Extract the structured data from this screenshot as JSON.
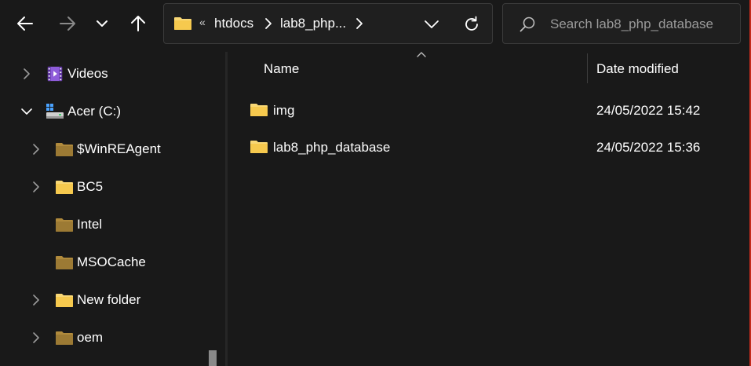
{
  "toolbar": {
    "back_icon": "arrow-left-icon",
    "forward_icon": "arrow-right-icon",
    "recent_icon": "chevron-down-icon",
    "up_icon": "arrow-up-icon"
  },
  "address": {
    "overflow_marker": "«",
    "crumbs": [
      "htdocs",
      "lab8_php..."
    ],
    "folder_icon": "folder-icon",
    "dropdown_icon": "chevron-down-icon",
    "refresh_icon": "refresh-icon"
  },
  "search": {
    "placeholder": "Search lab8_php_database",
    "icon": "search-icon"
  },
  "sidebar": {
    "items": [
      {
        "label": "Videos",
        "icon": "videos-folder-icon",
        "expander": "collapsed"
      },
      {
        "label": "Acer (C:)",
        "icon": "drive-icon",
        "expander": "expanded"
      },
      {
        "label": "$WinREAgent",
        "icon": "folder-icon",
        "expander": "collapsed"
      },
      {
        "label": "BC5",
        "icon": "folder-icon",
        "expander": "collapsed"
      },
      {
        "label": "Intel",
        "icon": "folder-icon",
        "expander": "none"
      },
      {
        "label": "MSOCache",
        "icon": "folder-icon",
        "expander": "none"
      },
      {
        "label": "New folder",
        "icon": "folder-icon",
        "expander": "collapsed"
      },
      {
        "label": "oem",
        "icon": "folder-icon",
        "expander": "collapsed"
      }
    ]
  },
  "list": {
    "columns": {
      "name": "Name",
      "date_modified": "Date modified"
    },
    "rows": [
      {
        "name": "img",
        "date_modified": "24/05/2022 15:42",
        "icon": "folder-icon"
      },
      {
        "name": "lab8_php_database",
        "date_modified": "24/05/2022 15:36",
        "icon": "folder-icon"
      }
    ]
  },
  "colors": {
    "background": "#191919",
    "folder_yellow": "#f8d775",
    "folder_dim": "#c9a24a",
    "accent_red": "#c42b1c"
  }
}
